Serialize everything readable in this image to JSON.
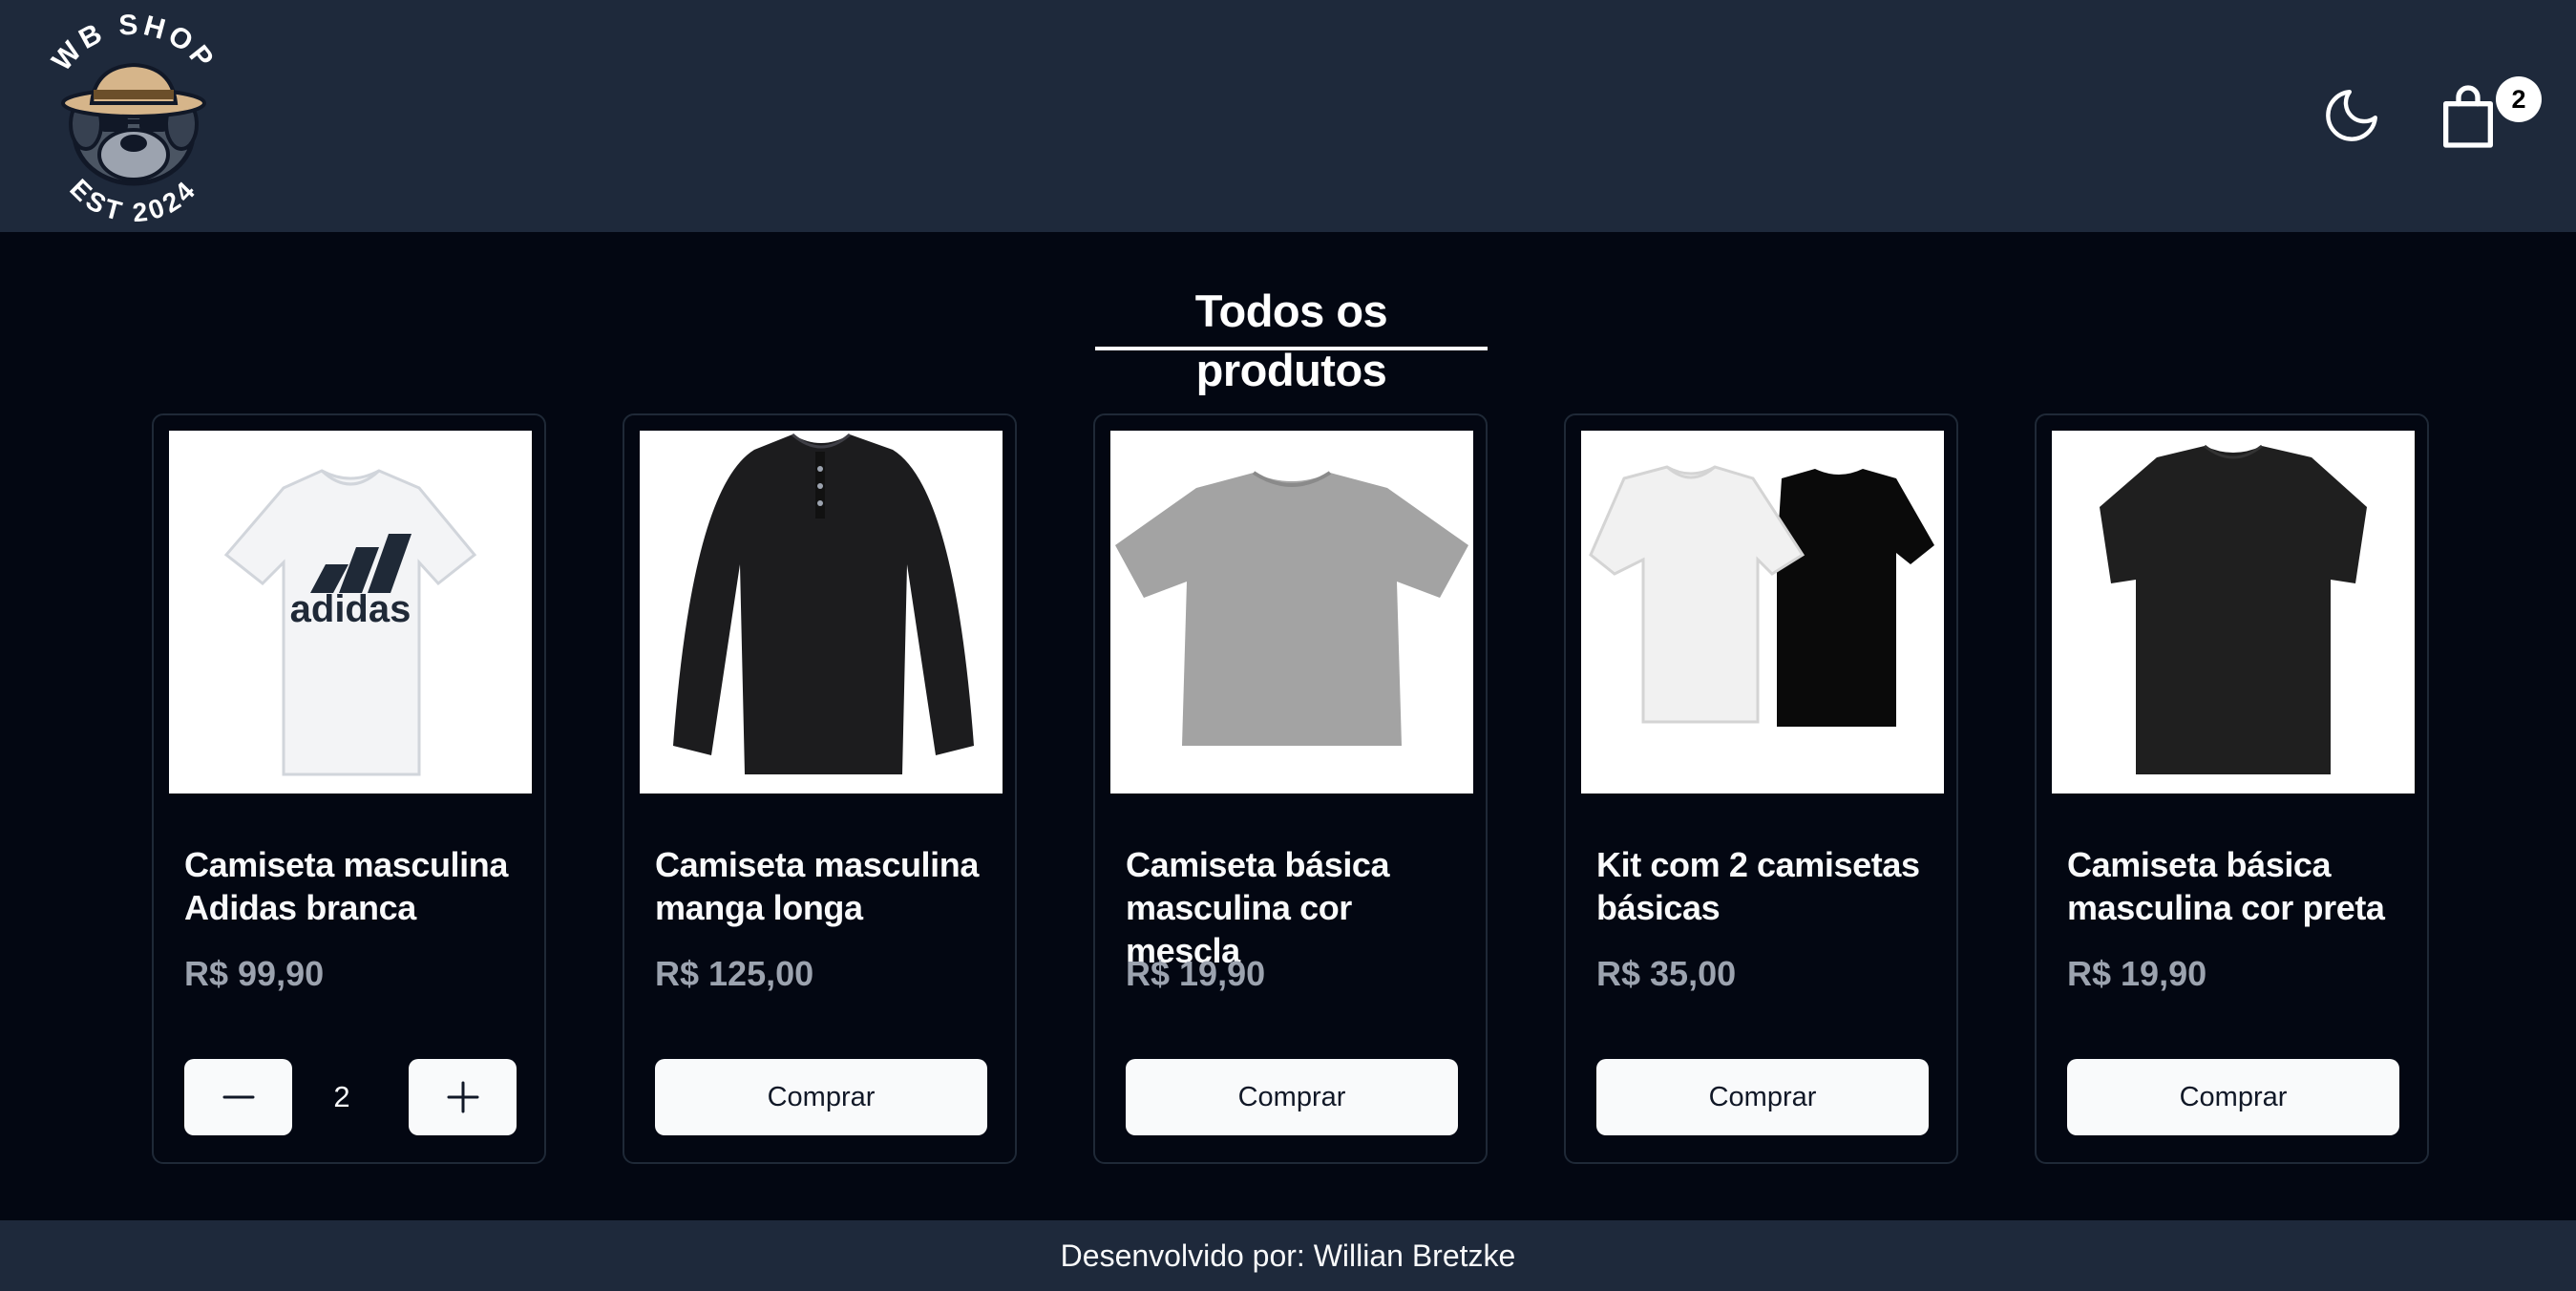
{
  "header": {
    "logo": {
      "top_text": "WB SHOP",
      "bottom_text": "EST 2024",
      "icon": "bulldog-with-hat-logo"
    },
    "theme_toggle_icon": "moon-icon",
    "cart": {
      "icon": "shopping-bag-icon",
      "count": "2"
    }
  },
  "main": {
    "title": "Todos os produtos",
    "products": [
      {
        "name": "Camiseta masculina Adidas branca",
        "price": "R$ 99,90",
        "image": "white-adidas-tshirt",
        "quantity": "2",
        "in_cart": true
      },
      {
        "name": "Camiseta masculina manga longa",
        "price": "R$ 125,00",
        "image": "black-long-sleeve-henley",
        "button_label": "Comprar"
      },
      {
        "name": "Camiseta básica masculina cor mescla",
        "price": "R$ 19,90",
        "image": "grey-tshirt",
        "button_label": "Comprar"
      },
      {
        "name": "Kit com 2 camisetas básicas",
        "price": "R$ 35,00",
        "image": "white-and-black-tshirts",
        "button_label": "Comprar"
      },
      {
        "name": "Camiseta básica masculina cor preta",
        "price": "R$ 19,90",
        "image": "black-tshirt",
        "button_label": "Comprar"
      }
    ],
    "quantity_controls": {
      "decrement_icon": "minus-icon",
      "increment_icon": "plus-icon"
    }
  },
  "footer": {
    "text": "Desenvolvido por: Willian Bretzke"
  },
  "colors": {
    "header_bg": "#1e293b",
    "page_bg": "#030712",
    "button_bg": "#f9fafb",
    "price_text": "#9ca3af"
  }
}
